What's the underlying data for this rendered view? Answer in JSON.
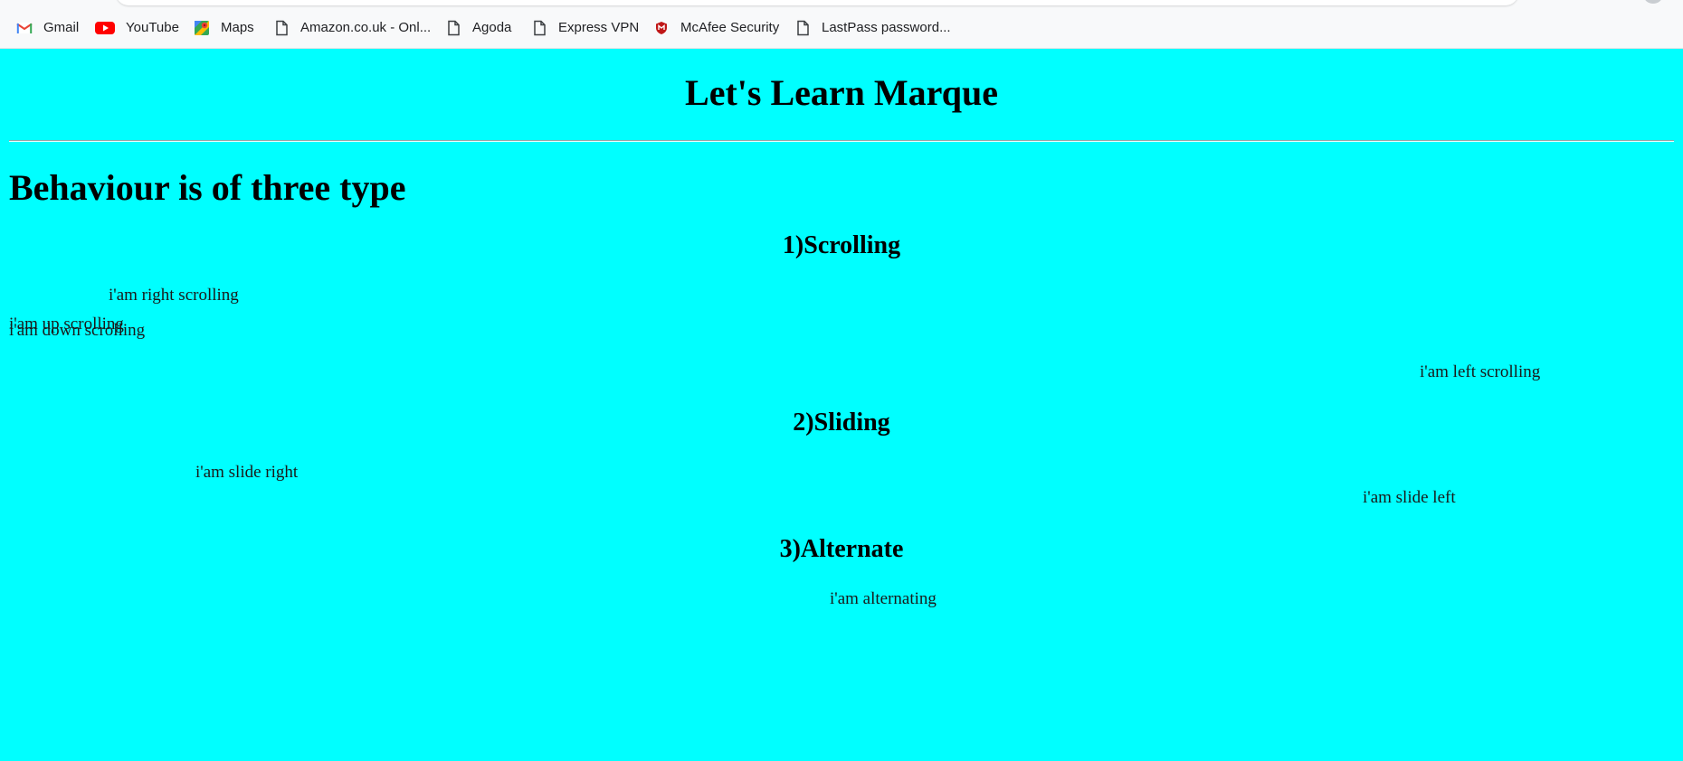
{
  "bookmarks": [
    {
      "label": "Gmail",
      "icon": "gmail-icon"
    },
    {
      "label": "YouTube",
      "icon": "youtube-icon"
    },
    {
      "label": "Maps",
      "icon": "maps-icon"
    },
    {
      "label": "Amazon.co.uk - Onl...",
      "icon": "page-icon"
    },
    {
      "label": "Agoda",
      "icon": "page-icon"
    },
    {
      "label": "Express VPN",
      "icon": "page-icon"
    },
    {
      "label": "McAfee Security",
      "icon": "mcafee-icon"
    },
    {
      "label": "LastPass password...",
      "icon": "page-icon"
    }
  ],
  "page": {
    "background": "#00ffff",
    "title": "Let's Learn Marque",
    "heading": "Behaviour is of three type",
    "sections": {
      "scrolling": {
        "title": "1)Scrolling",
        "right": "i'am right scrolling",
        "up": "i'am up scrolling",
        "down": "i'am down scrolling",
        "left": "i'am left scrolling"
      },
      "sliding": {
        "title": "2)Sliding",
        "right": "i'am slide right",
        "left": "i'am slide left"
      },
      "alternate": {
        "title": "3)Alternate",
        "text": "i'am alternating"
      }
    }
  }
}
